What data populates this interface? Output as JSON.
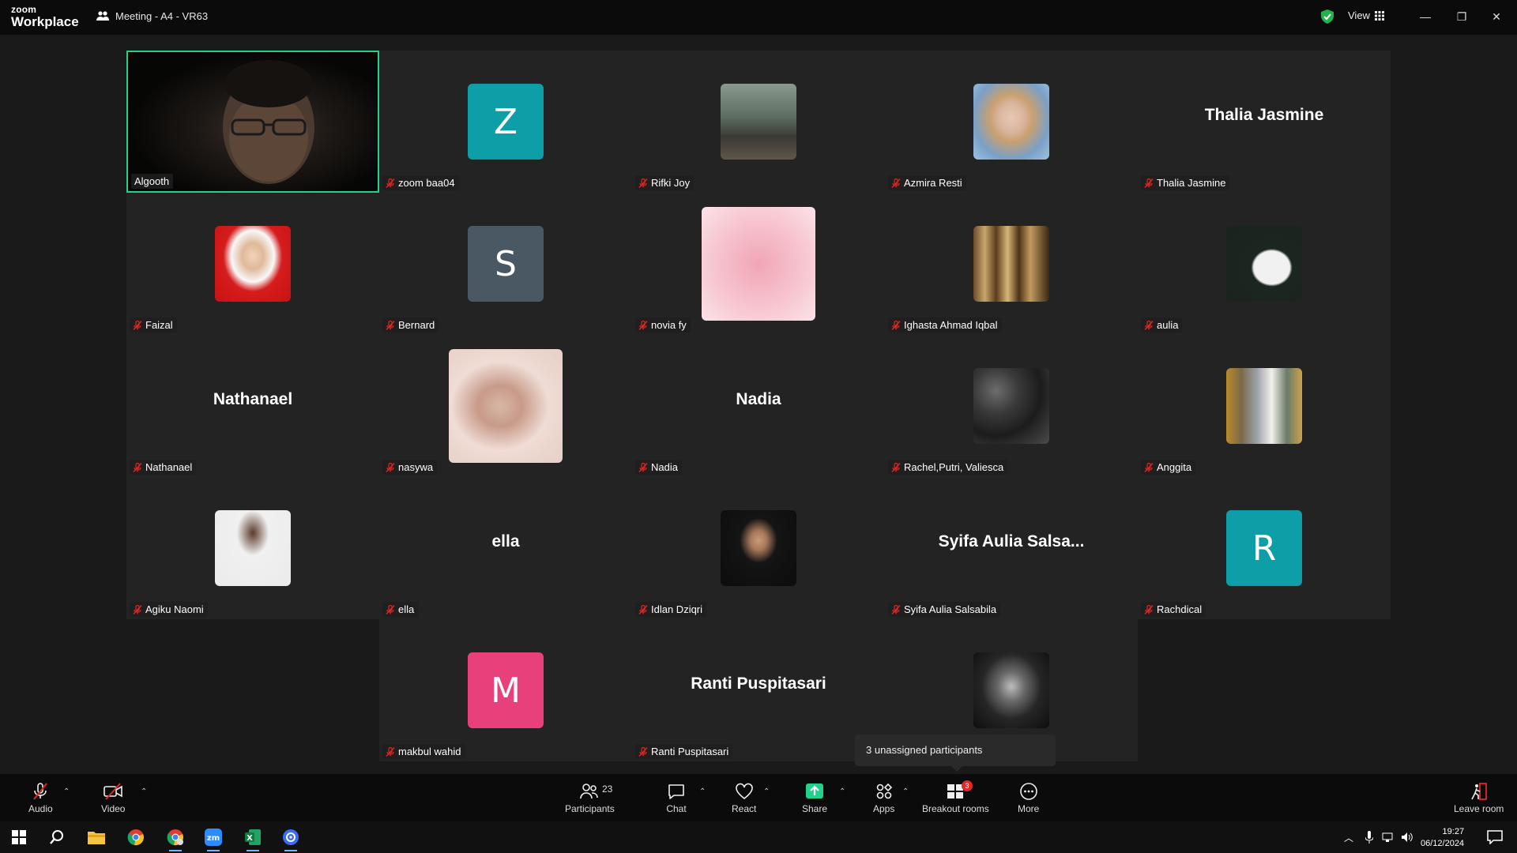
{
  "app": {
    "brand_top": "zoom",
    "brand_bottom": "Workplace",
    "meeting_title": "Meeting - A4 - VR63",
    "view_label": "View"
  },
  "participants": [
    {
      "name": "Algooth",
      "display": "video"
    },
    {
      "name": "zoom baa04",
      "display": "letter",
      "letter": "Z",
      "color": "#0e9ea8"
    },
    {
      "name": "Rifki Joy",
      "display": "photo",
      "photo": "rifki"
    },
    {
      "name": "Azmira Resti",
      "display": "photo",
      "photo": "azmira"
    },
    {
      "name": "Thalia Jasmine",
      "display": "name",
      "big": "Thalia Jasmine"
    },
    {
      "name": "Faizal",
      "display": "photo",
      "photo": "faizal"
    },
    {
      "name": "Bernard",
      "display": "letter",
      "letter": "S",
      "color": "#4a5864"
    },
    {
      "name": "novia fy",
      "display": "photo",
      "photo": "novia",
      "big_photo": true
    },
    {
      "name": "Ighasta Ahmad Iqbal",
      "display": "photo",
      "photo": "ighasta"
    },
    {
      "name": "aulia",
      "display": "photo",
      "photo": "aulia"
    },
    {
      "name": "Nathanael",
      "display": "name",
      "big": "Nathanael"
    },
    {
      "name": "nasywa",
      "display": "photo",
      "photo": "nasywa",
      "big_photo": true
    },
    {
      "name": "Nadia",
      "display": "name",
      "big": "Nadia"
    },
    {
      "name": "Rachel,Putri, Valiesca",
      "display": "photo",
      "photo": "rachel"
    },
    {
      "name": "Anggita",
      "display": "photo",
      "photo": "anggita"
    },
    {
      "name": "Agiku Naomi",
      "display": "photo",
      "photo": "agiku"
    },
    {
      "name": "ella",
      "display": "name",
      "big": "ella"
    },
    {
      "name": "Idlan Dziqri",
      "display": "photo",
      "photo": "idlan"
    },
    {
      "name": "Syifa Aulia Salsabila",
      "display": "name",
      "big": "Syifa  Aulia  Salsa..."
    },
    {
      "name": "Rachdical",
      "display": "letter",
      "letter": "R",
      "color": "#0e9ea8"
    },
    {
      "name": "makbul wahid",
      "display": "letter",
      "letter": "M",
      "color": "#e8407a"
    },
    {
      "name": "Ranti Puspitasari",
      "display": "name",
      "big": "Ranti Puspitasari"
    },
    {
      "name": "",
      "display": "photo",
      "photo": "singer"
    }
  ],
  "tooltip": "3 unassigned participants",
  "toolbar": {
    "audio": "Audio",
    "video": "Video",
    "participants": "Participants",
    "participants_count": "23",
    "chat": "Chat",
    "react": "React",
    "share": "Share",
    "apps": "Apps",
    "breakout": "Breakout rooms",
    "breakout_badge": "3",
    "more": "More",
    "leave": "Leave room"
  },
  "taskbar": {
    "time": "19:27",
    "date": "06/12/2024"
  },
  "colors": {
    "active_speaker": "#23d18b",
    "share_green": "#23d18b"
  }
}
